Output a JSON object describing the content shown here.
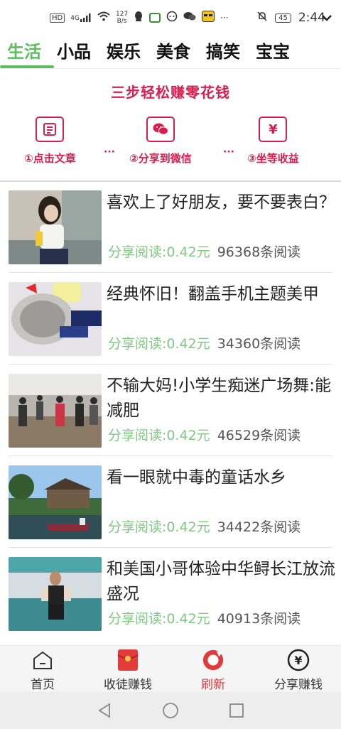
{
  "status_bar": {
    "network": "HD",
    "signal": "4G",
    "speed_value": "127",
    "speed_unit": "B/s",
    "battery": "45",
    "time": "2:44"
  },
  "tabs": [
    "生活",
    "小品",
    "娱乐",
    "美食",
    "搞笑",
    "宝宝"
  ],
  "active_tab_index": 0,
  "earn_banner": {
    "title": "三步轻松赚零花钱",
    "separator": "···",
    "steps": [
      {
        "label": "①点击文章",
        "icon": "article-icon"
      },
      {
        "label": "②分享到微信",
        "icon": "wechat-icon"
      },
      {
        "label": "③坐等收益",
        "icon": "yuan-icon"
      }
    ]
  },
  "articles": [
    {
      "title": "喜欢上了好朋友，要不要表白？",
      "reward": "分享阅读:0.42元",
      "reads": "96368条阅读"
    },
    {
      "title": "经典怀旧！翻盖手机主题美甲",
      "reward": "分享阅读:0.42元",
      "reads": "34360条阅读"
    },
    {
      "title": "不输大妈!小学生痴迷广场舞:能减肥",
      "reward": "分享阅读:0.42元",
      "reads": "46529条阅读"
    },
    {
      "title": "看一眼就中毒的童话水乡",
      "reward": "分享阅读:0.42元",
      "reads": "34422条阅读"
    },
    {
      "title": "和美国小哥体验中华鲟长江放流盛况",
      "reward": "分享阅读:0.42元",
      "reads": "40913条阅读"
    }
  ],
  "bottom_nav": [
    {
      "label": "首页",
      "icon": "home-icon"
    },
    {
      "label": "收徒赚钱",
      "icon": "red-envelope-icon"
    },
    {
      "label": "刷新",
      "icon": "refresh-icon"
    },
    {
      "label": "分享赚钱",
      "icon": "yuan-coin-icon"
    }
  ],
  "active_nav_index": 2,
  "colors": {
    "accent_green": "#5cbf5f",
    "banner_red": "#d81e4f",
    "reward_green": "#7ec880",
    "refresh_red": "#e03b3b"
  }
}
